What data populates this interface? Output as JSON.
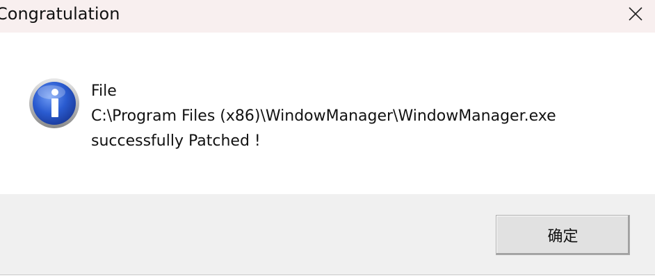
{
  "window": {
    "title": "Congratulation",
    "close_icon": "close-icon"
  },
  "message": {
    "icon": "info-icon",
    "line1": "File",
    "line2": "C:\\Program Files (x86)\\WindowManager\\WindowManager.exe",
    "line3": "successfully Patched !"
  },
  "buttons": {
    "ok_label": "确定"
  },
  "colors": {
    "titlebar_bg": "#f8efef",
    "footer_bg": "#f0f0f0",
    "icon_blue": "#2a5bd0"
  }
}
